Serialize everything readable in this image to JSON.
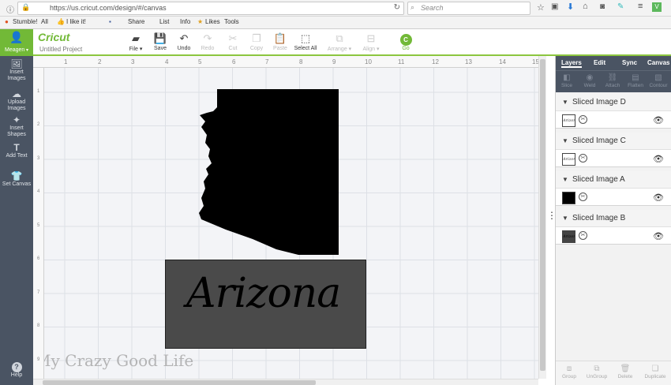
{
  "browser": {
    "url": "https://us.cricut.com/design/#/canvas",
    "search_placeholder": "Search",
    "bookmarks": [
      "Stumble!",
      "All",
      "I like it!",
      "Share",
      "List",
      "Info",
      "Likes",
      "Tools"
    ]
  },
  "header": {
    "user_name": "Meagen",
    "brand": "Cricut",
    "project_title": "Untitled Project",
    "toolbar": [
      {
        "label": "File",
        "icon": "folder-icon",
        "enabled": true
      },
      {
        "label": "Save",
        "icon": "save-icon",
        "enabled": true
      },
      {
        "label": "Undo",
        "icon": "undo-icon",
        "enabled": true
      },
      {
        "label": "Redo",
        "icon": "redo-icon",
        "enabled": false
      },
      {
        "label": "Cut",
        "icon": "cut-icon",
        "enabled": false
      },
      {
        "label": "Copy",
        "icon": "copy-icon",
        "enabled": false
      },
      {
        "label": "Paste",
        "icon": "paste-icon",
        "enabled": false
      },
      {
        "label": "Select All",
        "icon": "select-all-icon",
        "enabled": true
      },
      {
        "label": "Arrange",
        "icon": "arrange-icon",
        "enabled": false
      },
      {
        "label": "Align",
        "icon": "align-icon",
        "enabled": false
      },
      {
        "label": "Go",
        "icon": "go-icon",
        "enabled": true
      }
    ]
  },
  "sidebar": {
    "items": [
      {
        "label": "Insert Images",
        "icon": "image-icon"
      },
      {
        "label": "Upload Images",
        "icon": "upload-cloud-icon"
      },
      {
        "label": "Insert Shapes",
        "icon": "shapes-icon"
      },
      {
        "label": "Add Text",
        "icon": "text-icon"
      },
      {
        "label": "Set Canvas",
        "icon": "shirt-icon"
      }
    ],
    "help": "Help"
  },
  "canvas": {
    "ruler_x": [
      "1",
      "2",
      "3",
      "4",
      "5",
      "6",
      "7",
      "8",
      "9",
      "10",
      "11",
      "12",
      "13",
      "14",
      "15"
    ],
    "ruler_y": [
      "1",
      "2",
      "3",
      "4",
      "5",
      "6",
      "7",
      "8",
      "9"
    ],
    "text_art": "Arizona",
    "watermark": "My Crazy Good Life"
  },
  "panel": {
    "tabs": [
      "Layers",
      "Edit",
      "Sync",
      "Canvas"
    ],
    "tools": [
      "Slice",
      "Weld",
      "Attach",
      "Flatten",
      "Contour"
    ],
    "layers": [
      {
        "name": "Sliced Image D",
        "thumb": "Arizona"
      },
      {
        "name": "Sliced Image C",
        "thumb": "Arizona"
      },
      {
        "name": "Sliced Image A",
        "thumb": ""
      },
      {
        "name": "Sliced Image B",
        "thumb": "Arizona"
      }
    ],
    "footer": [
      "Group",
      "UnGroup",
      "Delete",
      "Duplicate"
    ]
  },
  "colors": {
    "accent": "#72b937",
    "sidebar": "#4a5463",
    "text_box": "#4a4a4a"
  }
}
